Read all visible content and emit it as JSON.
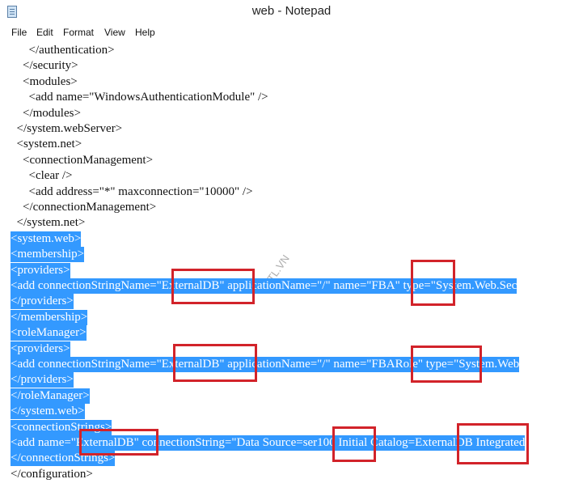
{
  "window": {
    "title": "web - Notepad",
    "app_icon": "notepad-icon"
  },
  "menu": [
    "File",
    "Edit",
    "Format",
    "View",
    "Help"
  ],
  "lines": [
    {
      "text": "      </authentication>",
      "selected": false
    },
    {
      "text": "    </security>",
      "selected": false
    },
    {
      "text": "    <modules>",
      "selected": false
    },
    {
      "text": "      <add name=\"WindowsAuthenticationModule\" />",
      "selected": false
    },
    {
      "text": "    </modules>",
      "selected": false
    },
    {
      "text": "  </system.webServer>",
      "selected": false
    },
    {
      "text": "  <system.net>",
      "selected": false
    },
    {
      "text": "    <connectionManagement>",
      "selected": false
    },
    {
      "text": "      <clear />",
      "selected": false
    },
    {
      "text": "      <add address=\"*\" maxconnection=\"10000\" />",
      "selected": false
    },
    {
      "text": "    </connectionManagement>",
      "selected": false
    },
    {
      "text": "  </system.net>",
      "selected": false
    },
    {
      "text": "<system.web>",
      "selected": true
    },
    {
      "text": "<membership>",
      "selected": true
    },
    {
      "text": "<providers>",
      "selected": true
    },
    {
      "text": "<add connectionStringName=\"ExternalDB\" applicationName=\"/\" name=\"FBA\" type=\"System.Web.Sec",
      "selected": true
    },
    {
      "text": "</providers>",
      "selected": true
    },
    {
      "text": "</membership>",
      "selected": true
    },
    {
      "text": "<roleManager>",
      "selected": true
    },
    {
      "text": "<providers>",
      "selected": true
    },
    {
      "text": "<add connectionStringName=\"ExternalDB\" applicationName=\"/\" name=\"FBARole\" type=\"System.Web",
      "selected": true
    },
    {
      "text": "</providers>",
      "selected": true
    },
    {
      "text": "</roleManager>",
      "selected": true
    },
    {
      "text": "</system.web>",
      "selected": true
    },
    {
      "text": "<connectionStrings>",
      "selected": true
    },
    {
      "text": "<add name=\"ExternalDB\" connectionString=\"Data Source=ser100 Initial Catalog=ExternalDB Integrated",
      "selected": true
    },
    {
      "text": "</connectionStrings>",
      "selected": true
    },
    {
      "text": "</configuration>",
      "selected": false
    }
  ],
  "watermark": "CTL.VN",
  "colors": {
    "selection": "#3399ff",
    "highlight_box": "#d2232a"
  }
}
